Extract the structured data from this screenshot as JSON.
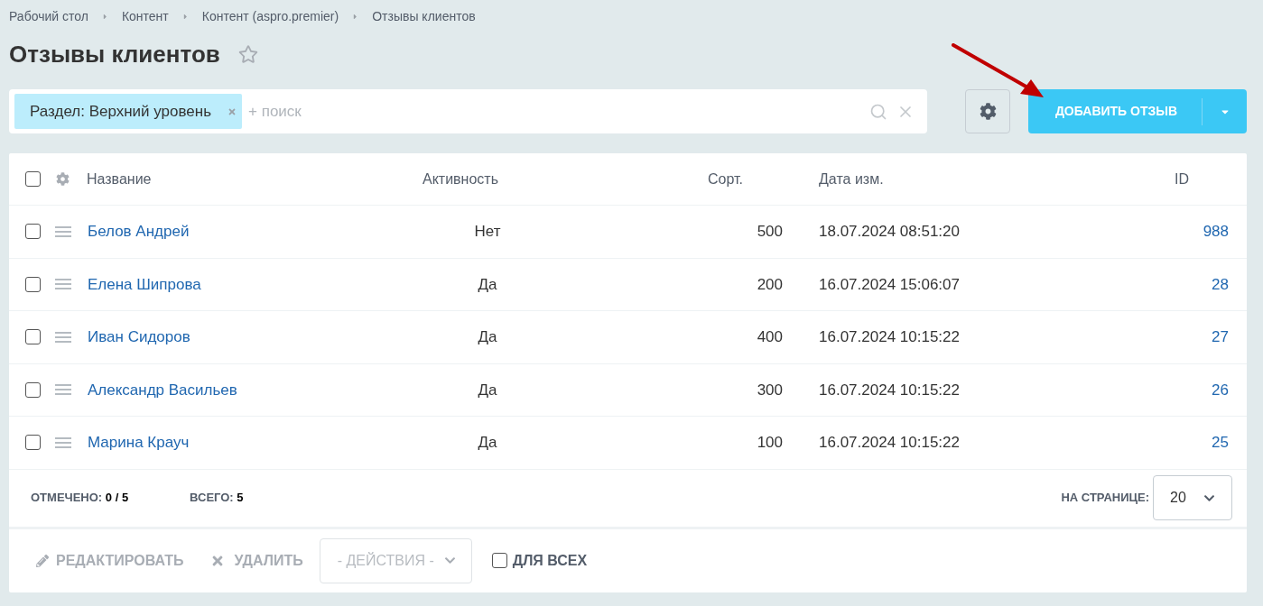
{
  "breadcrumbs": [
    "Рабочий стол",
    "Контент",
    "Контент (aspro.premier)",
    "Отзывы клиентов"
  ],
  "title": "Отзывы клиентов",
  "favorite": false,
  "filter": {
    "tag": "Раздел: Верхний уровень",
    "placeholder": "+ поиск"
  },
  "add_button": "ДОБАВИТЬ ОТЗЫВ",
  "table": {
    "all_checked": false,
    "columns": [
      "Название",
      "Активность",
      "Сорт.",
      "Дата изм.",
      "ID"
    ],
    "rows": [
      {
        "checked": false,
        "name": "Белов Андрей",
        "active": "Нет",
        "sort": "500",
        "date": "18.07.2024 08:51:20",
        "id": "988"
      },
      {
        "checked": false,
        "name": "Елена Шипрова",
        "active": "Да",
        "sort": "200",
        "date": "16.07.2024 15:06:07",
        "id": "28"
      },
      {
        "checked": false,
        "name": "Иван Сидоров",
        "active": "Да",
        "sort": "400",
        "date": "16.07.2024 10:15:22",
        "id": "27"
      },
      {
        "checked": false,
        "name": "Александр Васильев",
        "active": "Да",
        "sort": "300",
        "date": "16.07.2024 10:15:22",
        "id": "26"
      },
      {
        "checked": false,
        "name": "Марина Крауч",
        "active": "Да",
        "sort": "100",
        "date": "16.07.2024 10:15:22",
        "id": "25"
      }
    ]
  },
  "footer": {
    "selected_label": "ОТМЕЧЕНО:",
    "selected_value": "0 / 5",
    "total_label": "ВСЕГО:",
    "total_value": "5",
    "per_page_label": "НА СТРАНИЦЕ:",
    "per_page": "20"
  },
  "actions": {
    "edit": "РЕДАКТИРОВАТЬ",
    "delete": "УДАЛИТЬ",
    "dropdown": "- ДЕЙСТВИЯ -",
    "for_all": "ДЛЯ ВСЕХ",
    "for_all_checked": false
  }
}
